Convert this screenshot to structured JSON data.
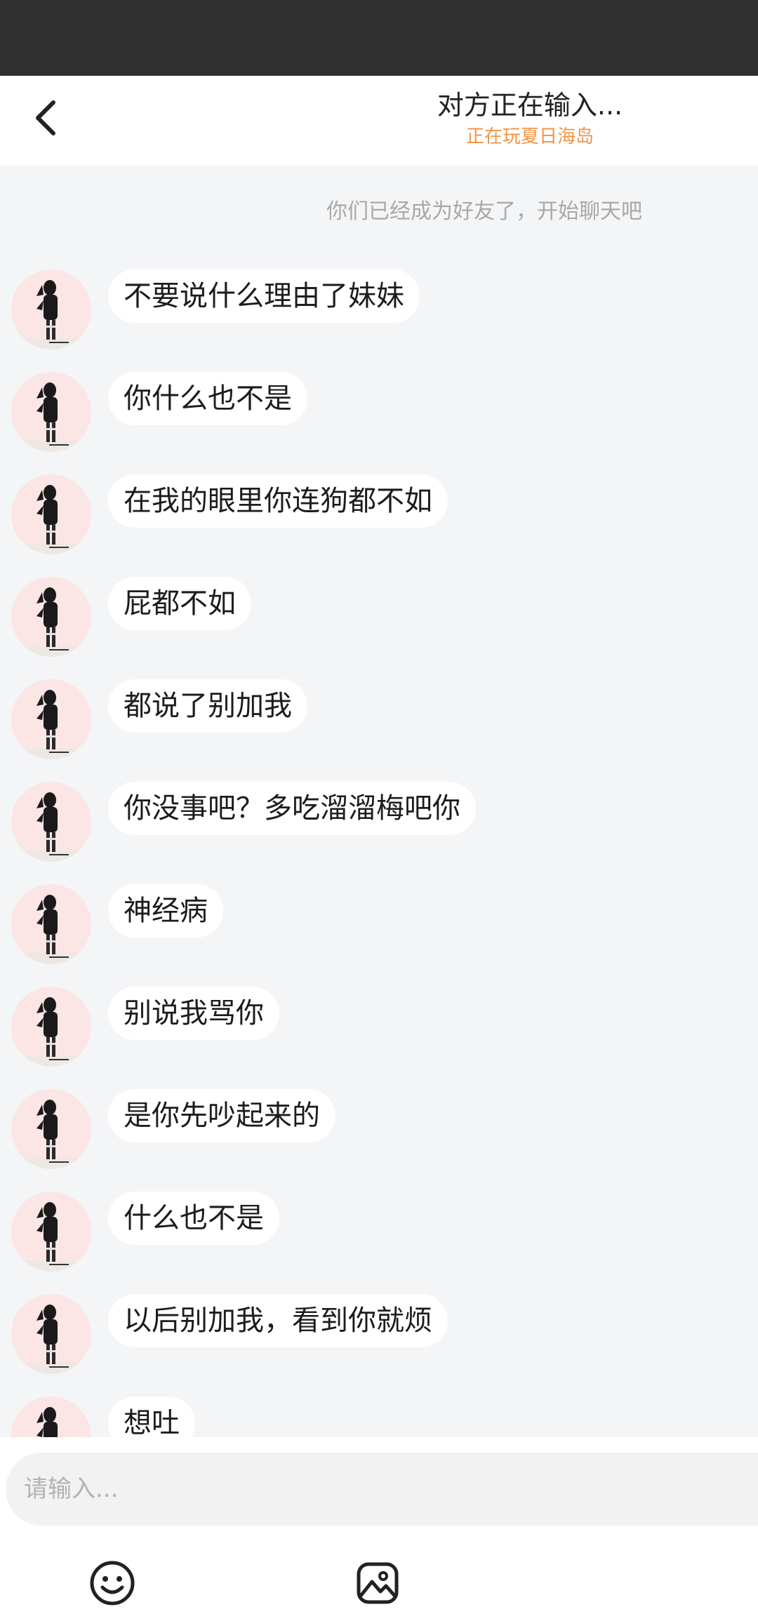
{
  "header": {
    "title": "对方正在输入...",
    "subtitle": "正在玩夏日海岛",
    "back_icon": "chevron-left-icon"
  },
  "chat": {
    "system_note": "你们已经成为好友了，开始聊天吧",
    "messages": [
      {
        "text": "不要说什么理由了妹妹"
      },
      {
        "text": "你什么也不是"
      },
      {
        "text": "在我的眼里你连狗都不如"
      },
      {
        "text": "屁都不如"
      },
      {
        "text": "都说了别加我"
      },
      {
        "text": "你没事吧？多吃溜溜梅吧你"
      },
      {
        "text": "神经病"
      },
      {
        "text": "别说我骂你"
      },
      {
        "text": "是你先吵起来的"
      },
      {
        "text": "什么也不是"
      },
      {
        "text": "以后别加我，看到你就烦"
      },
      {
        "text": "想吐"
      }
    ]
  },
  "composer": {
    "placeholder": "请输入...",
    "emoji_icon": "smiley-icon",
    "image_icon": "image-icon"
  },
  "colors": {
    "status_bar": "#2f2f2f",
    "subtitle": "#f29345",
    "chat_background": "#f4f5f7",
    "bubble": "#ffffff",
    "avatar_background": "#fbe5e5"
  }
}
